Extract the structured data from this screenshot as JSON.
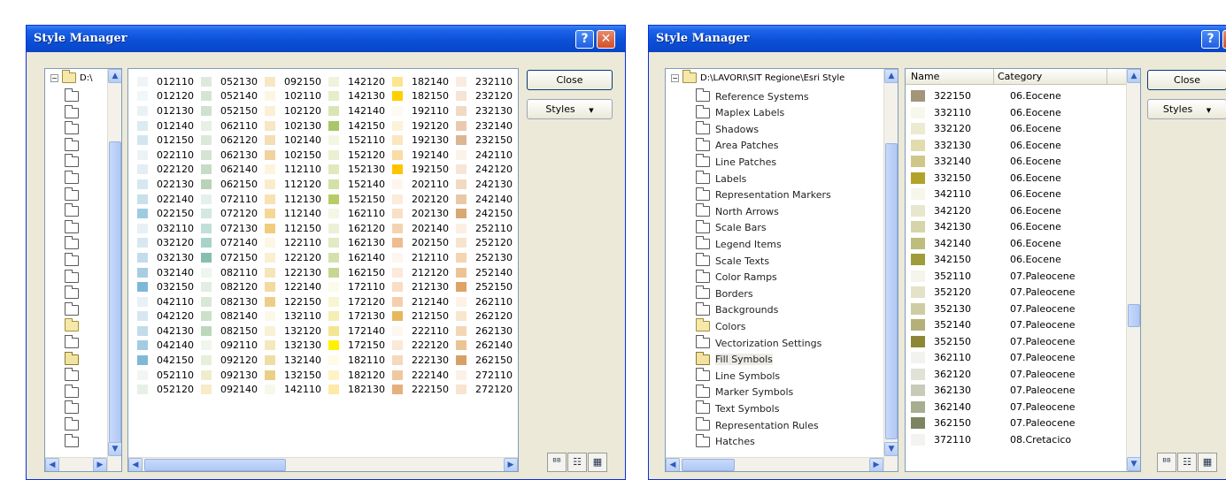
{
  "left_window": {
    "title": "Style Manager",
    "help_glyph": "?",
    "close_glyph": "✕",
    "tree_root_label": "D:\\",
    "tree_folder_count": 22,
    "grid_rows": [
      [
        [
          "012110",
          "#eef4f7"
        ],
        [
          "052130",
          "#dde9dc"
        ],
        [
          "092150",
          "#f7e7c2"
        ],
        [
          "142120",
          "#eef3dd"
        ],
        [
          "182140",
          "#fde58f"
        ],
        [
          "232110",
          "#f8ece0"
        ]
      ],
      [
        [
          "012120",
          "#f1f6f8"
        ],
        [
          "052140",
          "#d5e5d3"
        ],
        [
          "102110",
          "#fdf6e4"
        ],
        [
          "142130",
          "#e5eec9"
        ],
        [
          "182150",
          "#ffd000"
        ],
        [
          "232120",
          "#f6e4d5"
        ]
      ],
      [
        [
          "012130",
          "#e8f2f6"
        ],
        [
          "052150",
          "#cfe2cd"
        ],
        [
          "102120",
          "#fbefd5"
        ],
        [
          "142140",
          "#d8e6b5"
        ],
        [
          "192110",
          "#fefaf0"
        ],
        [
          "232130",
          "#f1d9c4"
        ]
      ],
      [
        [
          "012140",
          "#dcebf2"
        ],
        [
          "062110",
          "#e7efe6"
        ],
        [
          "102130",
          "#f8e6c4"
        ],
        [
          "142150",
          "#a9c76a"
        ],
        [
          "192120",
          "#fdf1d8"
        ],
        [
          "232140",
          "#e9cab0"
        ]
      ],
      [
        [
          "012150",
          "#d3e6ef"
        ],
        [
          "062120",
          "#dce9da"
        ],
        [
          "102140",
          "#f5ddb4"
        ],
        [
          "152110",
          "#f3f6e3"
        ],
        [
          "192130",
          "#fbe6c0"
        ],
        [
          "232150",
          "#dcb592"
        ]
      ],
      [
        [
          "022110",
          "#ecf3f6"
        ],
        [
          "062130",
          "#d3e4d1"
        ],
        [
          "102150",
          "#f1d39f"
        ],
        [
          "152120",
          "#eaf0d1"
        ],
        [
          "192140",
          "#f9dca6"
        ],
        [
          "242110",
          "#fbf2e8"
        ]
      ],
      [
        [
          "022120",
          "#e2eef3"
        ],
        [
          "062140",
          "#c7dcc5"
        ],
        [
          "112110",
          "#fdf4dc"
        ],
        [
          "152130",
          "#e0e9bd"
        ],
        [
          "192150",
          "#ffc400"
        ],
        [
          "242120",
          "#f7e6d6"
        ]
      ],
      [
        [
          "022130",
          "#d6e8ef"
        ],
        [
          "062150",
          "#b8d3b6"
        ],
        [
          "112120",
          "#fbecc9"
        ],
        [
          "152140",
          "#d3e0a6"
        ],
        [
          "202110",
          "#fef5ec"
        ],
        [
          "242130",
          "#f2d9c0"
        ]
      ],
      [
        [
          "022140",
          "#c7e0ea"
        ],
        [
          "072110",
          "#e5f0ee"
        ],
        [
          "112130",
          "#f8e2b2"
        ],
        [
          "152150",
          "#b7cc66"
        ],
        [
          "202120",
          "#fcebd9"
        ],
        [
          "242140",
          "#ebc8a5"
        ]
      ],
      [
        [
          "022150",
          "#9fcbe0"
        ],
        [
          "072120",
          "#d3e7e3"
        ],
        [
          "112140",
          "#f5d796"
        ],
        [
          "162110",
          "#f4f7e6"
        ],
        [
          "202130",
          "#f9e0c5"
        ],
        [
          "242150",
          "#d9a873"
        ]
      ],
      [
        [
          "032110",
          "#e6f0f6"
        ],
        [
          "072130",
          "#c1dfd8"
        ],
        [
          "112150",
          "#f2cc7d"
        ],
        [
          "162120",
          "#ebf1d6"
        ],
        [
          "202140",
          "#f6d3b0"
        ],
        [
          "252110",
          "#fcefe2"
        ]
      ],
      [
        [
          "032120",
          "#d8e8f1"
        ],
        [
          "072140",
          "#a9d2c8"
        ],
        [
          "122110",
          "#fcf6e2"
        ],
        [
          "162130",
          "#e1eac3"
        ],
        [
          "202150",
          "#eebc8f"
        ],
        [
          "252120",
          "#f8e3cc"
        ]
      ],
      [
        [
          "032130",
          "#c4dcea"
        ],
        [
          "072150",
          "#86bfae"
        ],
        [
          "122120",
          "#faefd0"
        ],
        [
          "162140",
          "#d5e1ad"
        ],
        [
          "212110",
          "#fef6ee"
        ],
        [
          "252130",
          "#f3d5b3"
        ]
      ],
      [
        [
          "032140",
          "#a8cde3"
        ],
        [
          "082110",
          "#eef5ef"
        ],
        [
          "122130",
          "#f6e5b9"
        ],
        [
          "162150",
          "#c7d693"
        ],
        [
          "212120",
          "#fce9d9"
        ],
        [
          "252140",
          "#ecc494"
        ]
      ],
      [
        [
          "032150",
          "#7db8d9"
        ],
        [
          "082120",
          "#e2eee2"
        ],
        [
          "122140",
          "#f2daa1"
        ],
        [
          "172110",
          "#fbfbe9"
        ],
        [
          "212130",
          "#f9ddc4"
        ],
        [
          "252150",
          "#dea365"
        ]
      ],
      [
        [
          "042110",
          "#e8f1f7"
        ],
        [
          "082130",
          "#d7e8d6"
        ],
        [
          "122150",
          "#eecd87"
        ],
        [
          "172120",
          "#f8f6d0"
        ],
        [
          "212140",
          "#f5cfab"
        ],
        [
          "262110",
          "#fdf2e4"
        ]
      ],
      [
        [
          "042120",
          "#d6e7f2"
        ],
        [
          "082140",
          "#cbe1c9"
        ],
        [
          "132110",
          "#fbf8e8"
        ],
        [
          "172130",
          "#f5efb2"
        ],
        [
          "212150",
          "#e9b65c"
        ],
        [
          "262120",
          "#f9e6cf"
        ]
      ],
      [
        [
          "042130",
          "#c2dcec"
        ],
        [
          "082150",
          "#bcd8ba"
        ],
        [
          "132120",
          "#f8f1d4"
        ],
        [
          "172140",
          "#f3e68f"
        ],
        [
          "222110",
          "#fef7ef"
        ],
        [
          "262130",
          "#f3d7b5"
        ]
      ],
      [
        [
          "042140",
          "#a5cbe2"
        ],
        [
          "092110",
          "#f1f6ec"
        ],
        [
          "132130",
          "#f4e8bc"
        ],
        [
          "172150",
          "#fff200"
        ],
        [
          "222120",
          "#fbe8d6"
        ],
        [
          "262140",
          "#ebc494"
        ]
      ],
      [
        [
          "042150",
          "#7ebad6"
        ],
        [
          "092120",
          "#e6efd9"
        ],
        [
          "132140",
          "#efdda4"
        ],
        [
          "182110",
          "#fffbe6"
        ],
        [
          "222130",
          "#f6d8bd"
        ],
        [
          "262150",
          "#d8a066"
        ]
      ],
      [
        [
          "052110",
          "#f1f6f3"
        ],
        [
          "092130",
          "#f0ecce"
        ],
        [
          "132150",
          "#e8d187"
        ],
        [
          "182120",
          "#fff3c6"
        ],
        [
          "222140",
          "#f0c8a0"
        ],
        [
          "272110",
          "#fcf1e6"
        ]
      ],
      [
        [
          "052120",
          "#e7f0e7"
        ],
        [
          "092140",
          "#f7ebc8"
        ],
        [
          "142110",
          "#f6f8ea"
        ],
        [
          "182130",
          "#fee9a6"
        ],
        [
          "222150",
          "#e6b07d"
        ],
        [
          "272120",
          "#f8e4cf"
        ]
      ]
    ],
    "close_button": "Close",
    "styles_button": "Styles",
    "styles_arrow": "▼",
    "view_small": "ᴮᴮ",
    "view_list": "☷",
    "view_details": "▦"
  },
  "right_window": {
    "title": "Style Manager",
    "help_glyph": "?",
    "tree_root_label": "D:\\LAVORI\\SIT Regione\\Esri Style",
    "tree_items": [
      "Reference Systems",
      "Maplex Labels",
      "Shadows",
      "Area Patches",
      "Line Patches",
      "Labels",
      "Representation Markers",
      "North Arrows",
      "Scale Bars",
      "Legend Items",
      "Scale Texts",
      "Color Ramps",
      "Borders",
      "Backgrounds",
      "Colors",
      "Vectorization Settings",
      "Fill Symbols",
      "Line Symbols",
      "Marker Symbols",
      "Text Symbols",
      "Representation Rules",
      "Hatches"
    ],
    "columns": [
      "Name",
      "Category"
    ],
    "rows": [
      [
        "322150",
        "06.Eocene",
        "#a29579"
      ],
      [
        "332110",
        "06.Eocene",
        "#f8f7ec"
      ],
      [
        "332120",
        "06.Eocene",
        "#ecead0"
      ],
      [
        "332130",
        "06.Eocene",
        "#e0dcae"
      ],
      [
        "332140",
        "06.Eocene",
        "#cfc68a"
      ],
      [
        "332150",
        "06.Eocene",
        "#b3a22a"
      ],
      [
        "342110",
        "06.Eocene",
        "#f6f6ea"
      ],
      [
        "342120",
        "06.Eocene",
        "#e8e7cd"
      ],
      [
        "342130",
        "06.Eocene",
        "#d6d5a9"
      ],
      [
        "342140",
        "06.Eocene",
        "#bebd7e"
      ],
      [
        "342150",
        "06.Eocene",
        "#9e9d3a"
      ],
      [
        "352110",
        "07.Paleocene",
        "#f5f5ec"
      ],
      [
        "352120",
        "07.Paleocene",
        "#e4e2c8"
      ],
      [
        "352130",
        "07.Paleocene",
        "#cfcca4"
      ],
      [
        "352140",
        "07.Paleocene",
        "#b5b07a"
      ],
      [
        "352150",
        "07.Paleocene",
        "#8d8636"
      ],
      [
        "362110",
        "07.Paleocene",
        "#f2f3ee"
      ],
      [
        "362120",
        "07.Paleocene",
        "#e0e2d6"
      ],
      [
        "362130",
        "07.Paleocene",
        "#c7cbb7"
      ],
      [
        "362140",
        "07.Paleocene",
        "#a7ad91"
      ],
      [
        "362150",
        "07.Paleocene",
        "#7c8560"
      ],
      [
        "372110",
        "08.Cretacico",
        "#f3f3ef"
      ]
    ],
    "close_button": "Close",
    "styles_button": "Styles",
    "styles_arrow": "▼",
    "view_small": "ᴮᴮ",
    "view_list": "☷",
    "view_details": "▦"
  }
}
